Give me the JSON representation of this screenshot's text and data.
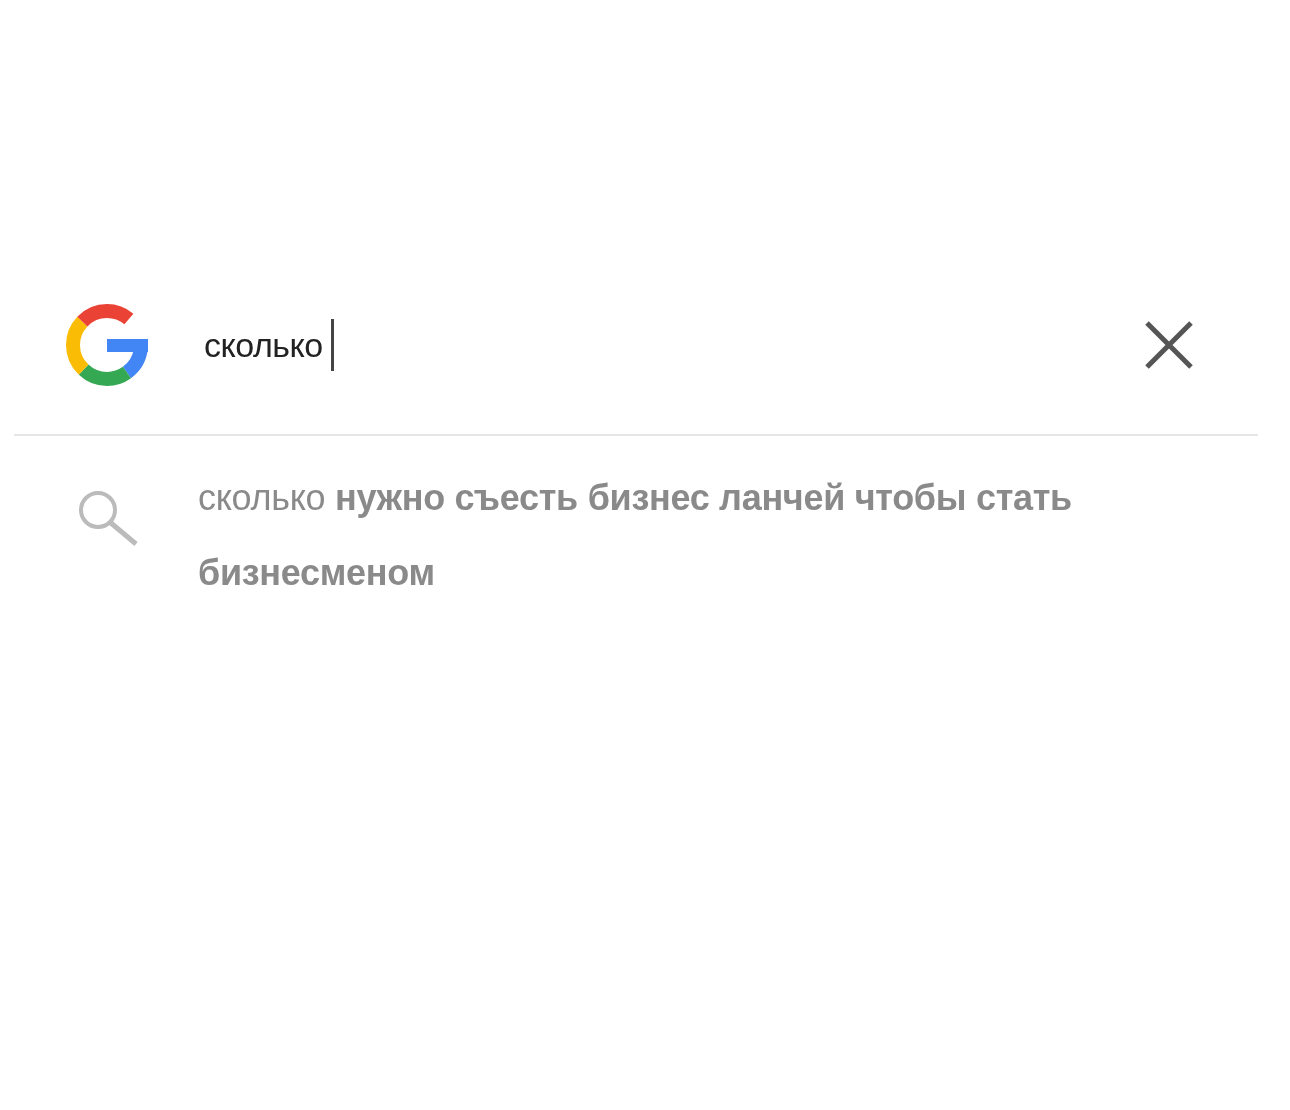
{
  "search": {
    "value": "сколько",
    "cursor": true
  },
  "suggestions": [
    {
      "text": "сколько **нужно съесть бизнес ланчей чтобы стать бизнесменом**"
    }
  ]
}
